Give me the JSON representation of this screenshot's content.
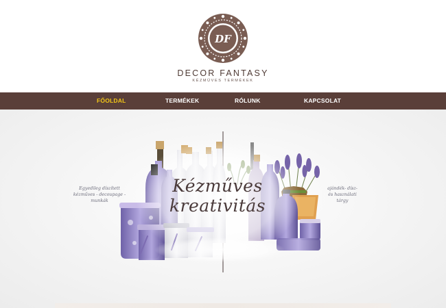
{
  "brand": {
    "name": "DECOR FANTASY",
    "tagline": "KÉZMŰVES TERMÉKEK",
    "monogram": "DF"
  },
  "nav": {
    "items": [
      {
        "label": "FŐOLDAL",
        "active": true
      },
      {
        "label": "TERMÉKEK",
        "active": false
      },
      {
        "label": "RÓLUNK",
        "active": false
      },
      {
        "label": "KAPCSOLAT",
        "active": false
      }
    ]
  },
  "hero": {
    "headline_line1": "Kézműves",
    "headline_line2": "kreativitás",
    "left_text": "Egyedileg díszített kézműves - decoupage - munkák",
    "right_text": "ajándék- dísz- és használati tárgy"
  },
  "colors": {
    "nav_bg": "#5a3f39",
    "nav_active": "#f2c617",
    "brand": "#6b4a40",
    "lavender": "#8d7cc4"
  }
}
